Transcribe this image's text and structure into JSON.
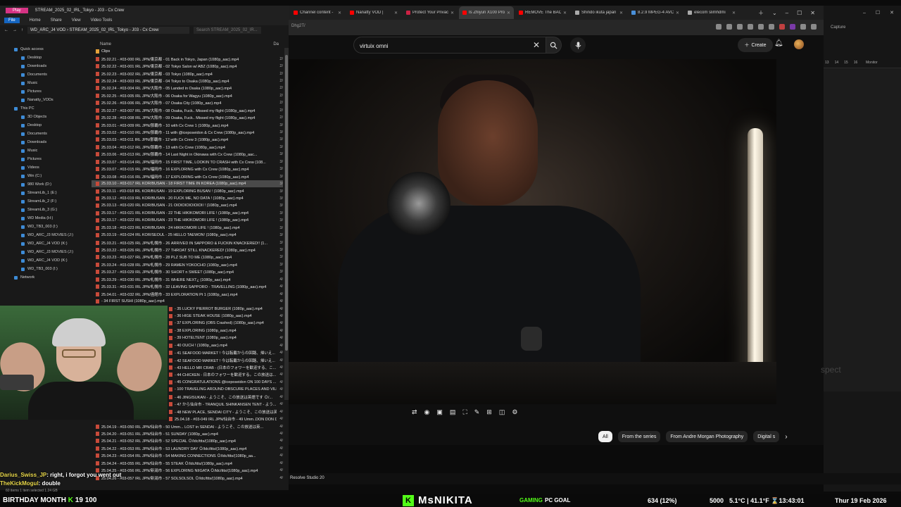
{
  "explorer": {
    "title": "STREAM_2025_02_IRL_Tokyo - J03 - Cx Crew",
    "play_tag": "Play",
    "ribbon": {
      "file": "File",
      "home": "Home",
      "share": "Share",
      "view": "View",
      "video_tools": "Video Tools"
    },
    "address": "WD_ARC_J4 VOD › STREAM_2025_02_IRL_Tokyo - J03 - Cx Crew",
    "search_placeholder": "Search STREAM_2025_02_IR...",
    "column_name": "Name",
    "column_date": "Da",
    "nav_items": [
      "Quick access",
      "Desktop",
      "Downloads",
      "Documents",
      "Music",
      "Pictures",
      "Nanatty_VODs",
      "This PC",
      "3D Objects",
      "Desktop",
      "Documents",
      "Downloads",
      "Music",
      "Pictures",
      "Videos",
      "Win (C:)",
      "980 Work (D:)",
      "StreamLib_1 (E:)",
      "StreamLib_2 (F:)",
      "StreamLib_3 (G:)",
      "WD Media (H:)",
      "WD_TB3_003 (I:)",
      "WD_ARC_J3 MOVIES (J:)",
      "WD_ARC_J4 VOD (K:)",
      "WD_ARC_J3 MOVIES (J:)",
      "WD_ARC_J4 VOD (K:)",
      "WD_TB3_003 (I:)",
      "Network"
    ],
    "files": [
      "Clips",
      "25.02.21 - #03-000 IRL JPN/東京都 - 01 Back in Tokyo, Japan (1080p_aac).mp4",
      "25.02.22 - #03-001 IRL JPN/東京都 - 02 Tokyo Salon w/ ABZ (1080p_aac).mp4",
      "25.02.23 - #03-002 IRL JPN/東京都 - 03 Tokyo (1080p_aac).mp4",
      "25.02.24 - #03-003 IRL JPN/東京都 - 04 Tokyo to Osaka (1080p_aac).mp4",
      "25.02.24 - #03-004 IRL JPN/大阪市 - 05 Landed in Osaka (1080p_aac).mp4",
      "25.02.25 - #03-005 IRL JPN/大阪市 - 06 Osaka for Wagyu (1080p_aac).mp4",
      "25.02.26 - #03-006 IRL JPN/大阪市 - 07 Osaka City (1080p_aac).mp4",
      "25.02.27 - #03-007 IRL JPN/大阪市 - 08 Osaka, Fuck.. Missed my flight (1080p_aac).mp4",
      "25.02.28 - #03-008 IRL JPN/大阪市 - 09 Osaka, Fuck.. Missed my flight (1080p_aac).mp4",
      "25.03.01 - #03-009 IRL JPN/那覇市 - 10 with Cx Crew 1 (1080p_aac).mp4",
      "25.03.02 - #03-010 IRL JPN/那覇市 - 11 with @iceposeidon & Cx Crew (1080p_aac).mp4",
      "25.03.03 - #03-011 IRL JPN/那覇市 - 12 with Cx Crew 3 (1080p_aac).mp4",
      "25.03.04 - #03-012 IRL JPN/那覇市 - 13 with Cx Crew (1080p_aac).mp4",
      "25.03.06 - #03-013 IRL JPN/那覇市 - 14 Last Night in Okinawa with Cx Crew (1080p_aac...",
      "25.03.07 - #03-014 IRL JPN/福岡市 - 15 FIRST TIME, LOOKIN TO CRASH with Cx Crew (108...",
      "25.03.07 - #03-015 IRL JPN/福岡市 - 16 EXPLORING with Cx Crew (1080p_aac).mp4",
      "25.03.08 - #03-016 IRL JPN/福岡市 - 17 EXPLORING with Cx Crew (1080p_aac).mp4",
      "25.03.10 - #03-017 IRL KOR/BUSAN - 18 FIRST TIME IN KOREA (1080p_aac).mp4",
      "25.03.11 - #03-018 IRL KOR/BUSAN - 19 EXPLORING BUSAN ! (1080p_aac).mp4",
      "25.03.12 - #03-019 IRL KOR/BUSAN - 20 FUCK ME, NO DATA ! (1080p_aac).mp4",
      "25.03.13 - #03-020 IRL KOR/BUSAN - 21 OIOIOIOIOIOIOII ! (1080p_aac).mp4",
      "25.03.17 - #03-021 IRL KOR/BUSAN - 22 THE HIKIKOMORI LIFE ! (1080p_aac).mp4",
      "25.03.17 - #03-022 IRL KOR/BUSAN - 23 THE HIKIKOMORI LIFE ! (1080p_aac).mp4",
      "25.03.18 - #03-023 IRL KOR/BUSAN - 24 HIKIKOMORI LIFE ! (1080p_aac).mp4",
      "25.03.19 - #03-024 IRL KOR/SEOUL - 25 HELLO TAEWON! (1080p_aac).mp4",
      "25.03.21 - #03-025 IRL JPN/札幌市 - 26 ARRIVED IN SAPPORO & FUCKIN KNACKERED!! (1...",
      "25.03.22 - #03-026 IRL JPN/札幌市 - 27 THROAT STILL KNACKERED! (1080p_aac).mp4",
      "25.03.23 - #03-027 IRL JPN/札幌市 - 28 PLZ SUB TO ME (1080p_aac).mp4",
      "25.03.24 - #03-028 IRL JPN/札幌市 - 29 RAMEN YOKOCHO (1080p_aac).mp4",
      "25.03.27 - #03-029 IRL JPN/札幌市 - 30 SHORT n SWEET (1080p_aac).mp4",
      "25.03.29 - #03-030 IRL JPN/札幌市 - 31 WHERE NEXT¿ (1080p_aac).mp4",
      "25.03.31 - #03-031 IRL JPN/札幌市 - 32 LEAVING SAPPORO - TRAVELLING (1080p_aac).mp4",
      "25.04.01 - #03-032 IRL JPN/函館市 - 33 EXPLORATION Pt 1 (1080p_aac).mp4",
      "- 34 FIRST SUSHI (1080p_aac).mp4",
      "- 35 LUCKY PIERROT BURGER (1080p_aac).mp4",
      "- 36 HIGE STEAK HOUSE (1080p_aac).mp4",
      "- 37 EXPLORING (OBS Crashed) (1080p_aac).mp4",
      "- 38 EXPLORING (1080p_aac).mp4",
      "- 39 HOTELTENT (1080p_aac).mp4",
      "- 40 OUCH ! (1080p_aac).mp4",
      "- 41 SEAFOOD MARKET ! 今は転載からの回路、帰いえ...",
      "- 42 SEAFOOD MARKET ! 今は転載からの回路、帰いえ...",
      "- 43 HELLO MR CRAB - (日本のフォワーを歓迎する、こ...",
      "- 44 CHICKEN - 日本のフォワーを歓迎する。この放送は...",
      "- 45 CONGRATULATIONS @iceposeidon ON 100 DAYS ...",
      "- 100 TRAVELING AROUND OBSCURE PLACES AND VILL...",
      "- 46 JINGISUKAN - ようこそ、この放送は英語です Ｏ/...",
      "- 47 から仙台市 - TRANQUIL SHINKANSEN TENT - よう...",
      "- 48 NEW PLACE, SENDAI CITY - ようこそ、この放送は英...",
      "25.04.18 - #03-049 IRL JPN/仙台市 - 49 Umm..DON DON DONKI - ようこそ、この放送は英...",
      "25.04.19 - #03-050 IRL JPN/仙台市 - 50 Umm... LOST in SENDAI - ようこそ、この放送は英...",
      "25.04.20 - #03-051 IRL JPN/仙台市 - 51 SUNDAY (1080p_aac).mp4",
      "25.04.21 - #03-052 IRL JPN/仙台市 - 52 SPECIAL Ｏ/ldc/ttts/(1080p_aac).mp4",
      "25.04.22 - #03-053 IRL JPN/仙台市 - 53 LAUNDRY DAY Ｏ/ldc/ttts/(1080p_aac).mp4",
      "25.04.23 - #03-054 IRL JPN/仙台市 - 54 MAKING CONNECTIONS Ｏ/ldc/ttts/(1080p_aa...",
      "25.04.24 - #03-055 IRL JPN/仙台市 - 55 STEAK Ｏ/ldc/ttts/(1080p_aac).mp4",
      "25.04.25 - #03-056 IRL JPN/新潟市 - 56 EXPLORING NIIGATA Ｏ/ldc/ttts/(1080p_aac).mp4",
      "25.04.26 - #03-057 IRL JPN/新潟市 - 57 SOLSOLSOL Ｏ/ldc/ttts/(1080p_aac).mp4"
    ],
    "file_dates": [
      "",
      "2/",
      "2/",
      "2/",
      "2/",
      "2/",
      "2/",
      "2/",
      "2/",
      "2/",
      "3/",
      "3/",
      "3/",
      "3/",
      "3/",
      "3/",
      "3/",
      "3/",
      "3/",
      "3/",
      "3/",
      "3/",
      "3/",
      "3/",
      "3/",
      "3/",
      "3/",
      "3/",
      "3/",
      "3/",
      "3/",
      "4/",
      "4/",
      "4/",
      "4/",
      "4/",
      "4/",
      "4/",
      "4/",
      "4/",
      "4/",
      "4/",
      "4/",
      "4/",
      "4/",
      "4/",
      "4/",
      "4/",
      "4/",
      "4/",
      "4/",
      "4/",
      "4/",
      "4/",
      "4/",
      "4/",
      "4/",
      "4/",
      "4/",
      "4/"
    ],
    "status": "60 items   1 item selected 1.24 GB"
  },
  "browser": {
    "tabs": [
      {
        "title": "Channel content -",
        "color": "#ff0000"
      },
      {
        "title": "Nanatty VOD |",
        "color": "#ff0000"
      },
      {
        "title": "Protect Your Privac",
        "color": "#cc2244"
      },
      {
        "title": "Is Zhiyun X100 Pro",
        "color": "#ff0000"
      },
      {
        "title": "REMOVE The BACK",
        "color": "#ff0000"
      },
      {
        "title": "Shindo ikuta japan",
        "color": "#aaaaaa"
      },
      {
        "title": "8.2.9 MPEG-4 AVC",
        "color": "#4a90d9"
      },
      {
        "title": "elecom slimhdmi",
        "color": "#aaaaaa"
      }
    ],
    "url_text": "Dhg2T/",
    "search_value": "virtuix omni",
    "create_label": "Create",
    "chips": [
      "All",
      "From the series",
      "From Andre Morgan Photography",
      "Digital s"
    ],
    "overlay_text": "spect"
  },
  "right_panel": {
    "capture": "Capture",
    "monitor": "Monitor",
    "levels": [
      "13",
      "14",
      "15",
      "16"
    ]
  },
  "taskbar": {
    "resolve": "Resolve Studio 20"
  },
  "chat": [
    {
      "user": "Darius_Swiss_JP",
      "text": ": right, i forgot you went out"
    },
    {
      "user": "TheKickMogul",
      "text": ": double"
    }
  ],
  "stream_bar": {
    "birthday": "BIRTHDAY MONTH",
    "count_a": "19",
    "count_b": "100",
    "streamer": "MsNIKITA",
    "goal_a": "GAMING",
    "goal_b": "PC GOAL",
    "progress": "634 (12%)",
    "number": "5000",
    "weather": "5.1°C | 41.1°F ⌛13:43:01",
    "date": "Thur 19 Feb 2026"
  }
}
